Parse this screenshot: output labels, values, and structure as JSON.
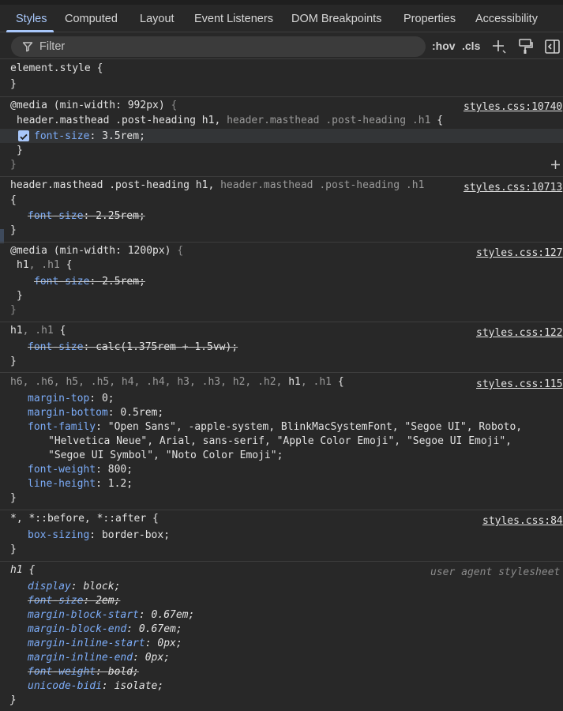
{
  "tabs": [
    "Styles",
    "Computed",
    "Layout",
    "Event Listeners",
    "DOM Breakpoints",
    "Properties",
    "Accessibility"
  ],
  "toolbar": {
    "filter_placeholder": "Filter",
    "hov": ":hov",
    "cls": ".cls"
  },
  "rules": {
    "r0": {
      "selector": "element.style {",
      "close": "}"
    },
    "r1": {
      "media": "@media (min-width: 992px) {",
      "media_at": "@media",
      "media_cond": "(min-width: 992px)",
      "media_brace": "{",
      "sel_a": "header.masthead .post-heading h1",
      "sel_sep": ", ",
      "sel_b": "header.masthead .post-heading .h1",
      "brace": " {",
      "prop": "font-size",
      "value": "3.5rem;",
      "close_inner": "}",
      "close_outer": "}",
      "source": "styles.css:10740"
    },
    "r2": {
      "sel_a": "header.masthead .post-heading h1",
      "sel_sep": ", ",
      "sel_b": "header.masthead .post-heading .h1",
      "open": "{",
      "prop": "font-size",
      "value": "2.25rem;",
      "close": "}",
      "source": "styles.css:10713"
    },
    "r3": {
      "media_at": "@media",
      "media_cond": "(min-width: 1200px)",
      "media_brace": "{",
      "sel_a": "h1",
      "sel_b": ", .h1",
      "brace": " {",
      "prop": "font-size",
      "value": "2.5rem;",
      "close_inner": "}",
      "close_outer": "}",
      "source": "styles.css:127"
    },
    "r4": {
      "sel_a": "h1",
      "sel_b": ", .h1",
      "brace": " {",
      "prop": "font-size",
      "value": "calc(1.375rem + 1.5vw);",
      "close": "}",
      "source": "styles.css:122"
    },
    "r5": {
      "sel_dim": "h6, .h6, h5, .h5, h4, .h4, h3, .h3, h2, .h2, ",
      "sel_a": "h1",
      "sel_b": ", .h1",
      "brace": " {",
      "props": [
        {
          "name": "margin-top",
          "value": "0;"
        },
        {
          "name": "margin-bottom",
          "value": "0.5rem;"
        },
        {
          "name": "font-family",
          "value": "\"Open Sans\", -apple-system, BlinkMacSystemFont, \"Segoe UI\", Roboto,"
        },
        {
          "name": "",
          "value": "\"Helvetica Neue\", Arial, sans-serif, \"Apple Color Emoji\", \"Segoe UI Emoji\","
        },
        {
          "name": "",
          "value": "\"Segoe UI Symbol\", \"Noto Color Emoji\";"
        },
        {
          "name": "font-weight",
          "value": "800;"
        },
        {
          "name": "line-height",
          "value": "1.2;"
        }
      ],
      "close": "}",
      "source": "styles.css:115"
    },
    "r6": {
      "selector": "*, *::before, *::after {",
      "prop": "box-sizing",
      "value": "border-box;",
      "close": "}",
      "source": "styles.css:84"
    },
    "r7": {
      "selector": "h1 {",
      "props": [
        {
          "name": "display",
          "value": "block;"
        },
        {
          "name": "font-size",
          "value": "2em;"
        },
        {
          "name": "margin-block-start",
          "value": "0.67em;"
        },
        {
          "name": "margin-block-end",
          "value": "0.67em;"
        },
        {
          "name": "margin-inline-start",
          "value": "0px;"
        },
        {
          "name": "margin-inline-end",
          "value": "0px;"
        },
        {
          "name": "font-weight",
          "value": "bold;"
        },
        {
          "name": "unicode-bidi",
          "value": "isolate;"
        }
      ],
      "close": "}",
      "source": "user agent stylesheet"
    }
  },
  "colors": {
    "accent": "#a8c7fa",
    "property": "#7cacf8",
    "background": "#282828"
  }
}
